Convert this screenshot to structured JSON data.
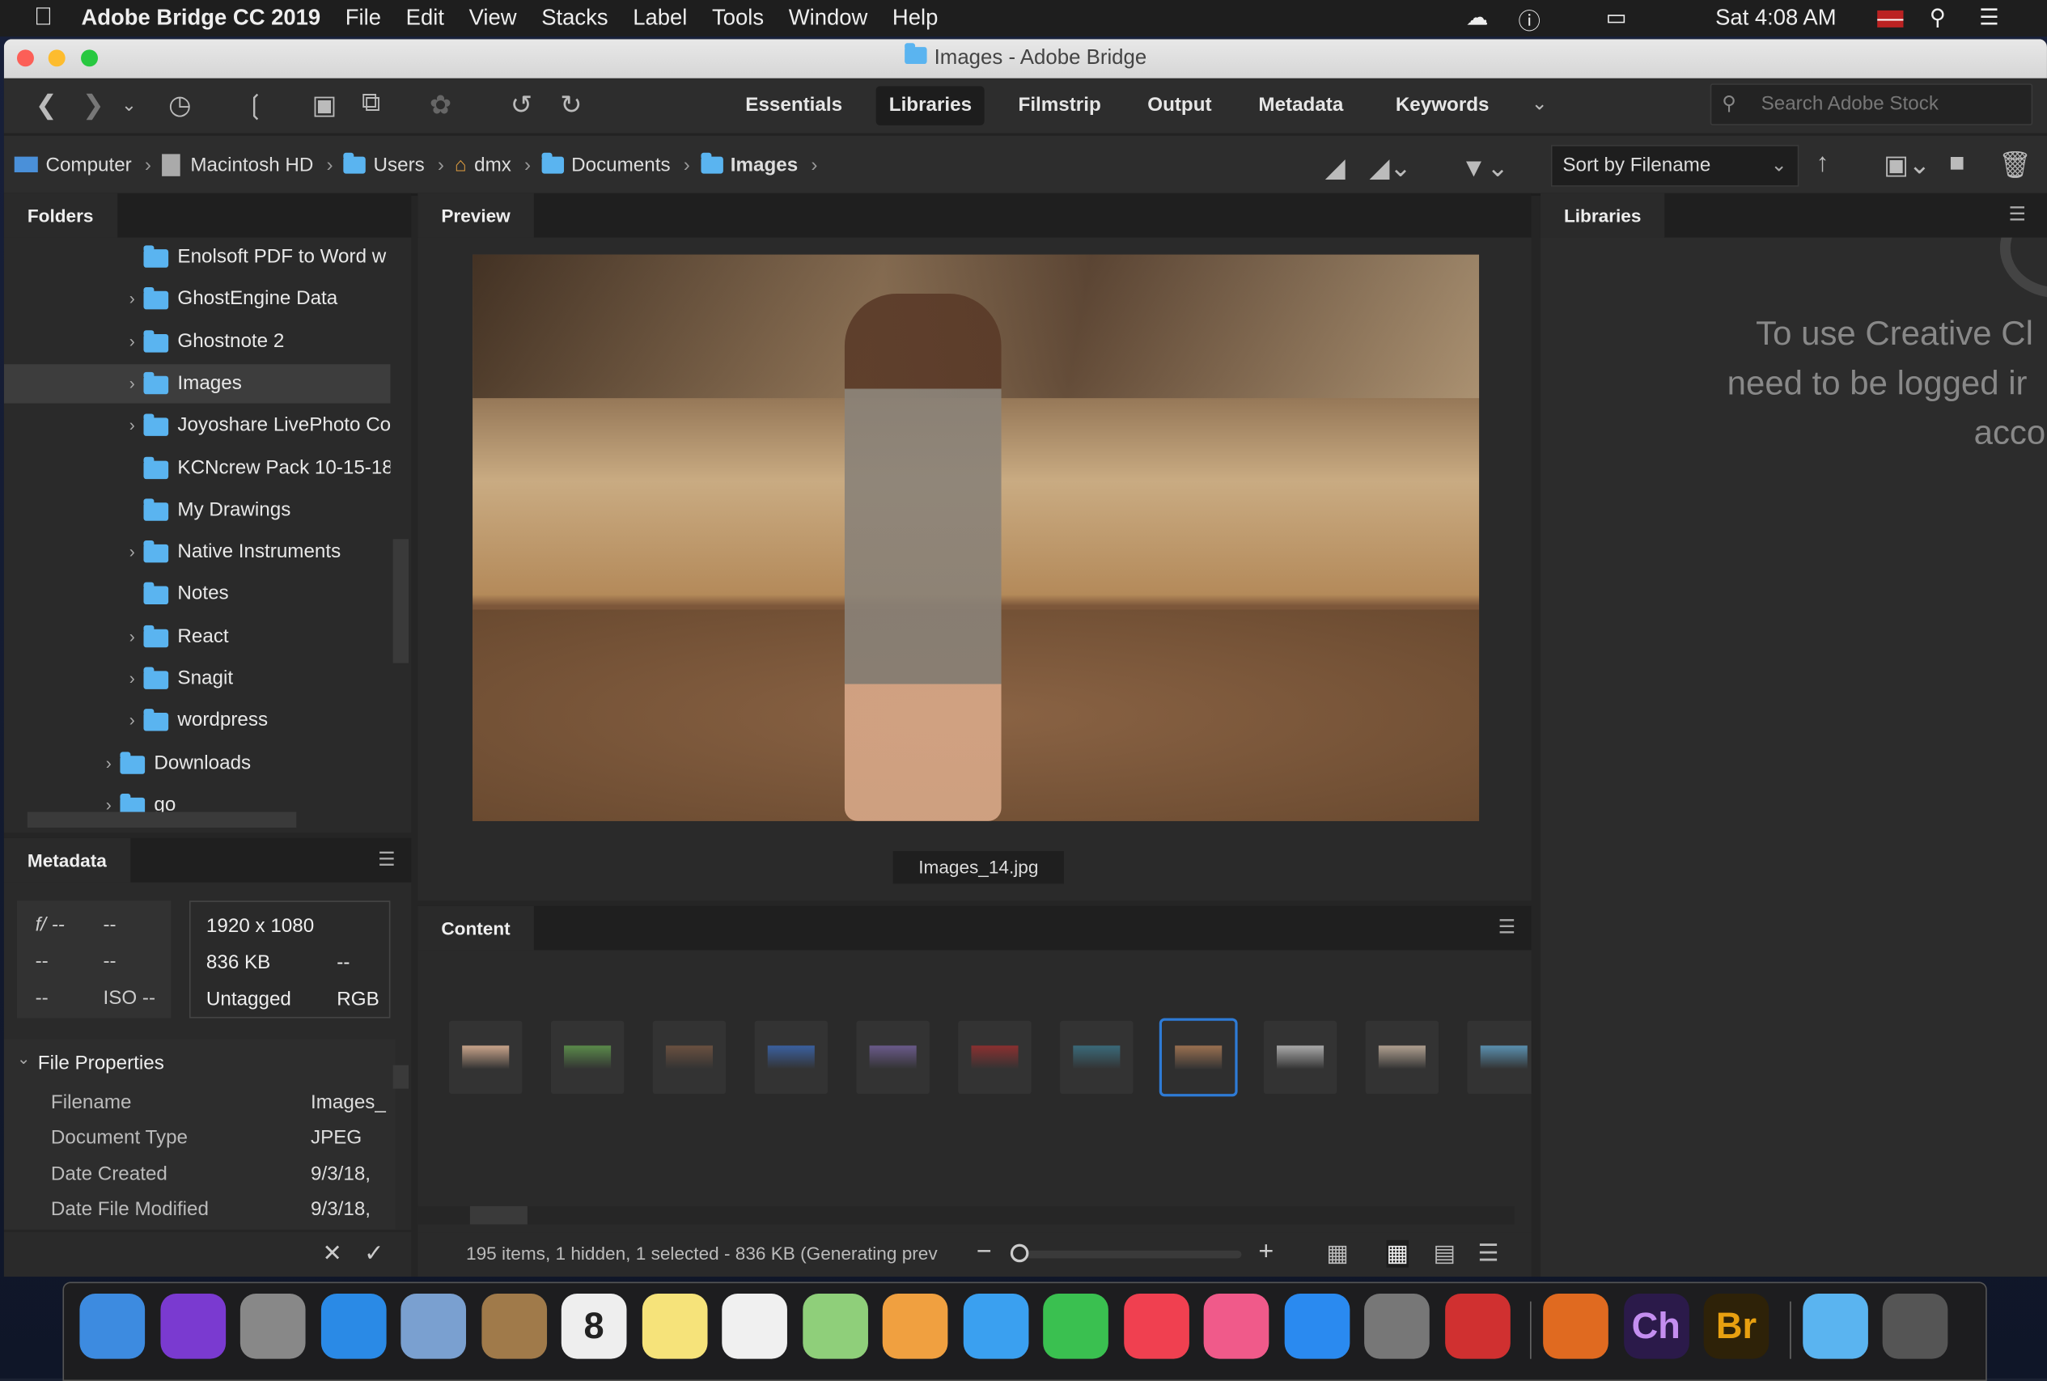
{
  "menubar": {
    "app": "Adobe Bridge CC 2019",
    "items": [
      "File",
      "Edit",
      "View",
      "Stacks",
      "Label",
      "Tools",
      "Window",
      "Help"
    ],
    "clock": "Sat 4:08 AM"
  },
  "window": {
    "title": "Images - Adobe Bridge"
  },
  "toolbar": {
    "workspaces": [
      "Essentials",
      "Libraries",
      "Filmstrip",
      "Output",
      "Metadata",
      "Keywords"
    ],
    "active_workspace": "Libraries",
    "search_placeholder": "Search Adobe Stock"
  },
  "path": {
    "crumbs": [
      "Computer",
      "Macintosh HD",
      "Users",
      "dmx",
      "Documents",
      "Images"
    ],
    "sort": "Sort by Filename"
  },
  "folders": {
    "tab": "Folders",
    "items": [
      {
        "label": "Enolsoft PDF to Word w",
        "expandable": false
      },
      {
        "label": "GhostEngine Data",
        "expandable": true
      },
      {
        "label": "Ghostnote 2",
        "expandable": true
      },
      {
        "label": "Images",
        "expandable": true,
        "selected": true
      },
      {
        "label": "Joyoshare LivePhoto Co",
        "expandable": true
      },
      {
        "label": "KCNcrew Pack 10-15-18",
        "expandable": false
      },
      {
        "label": "My Drawings",
        "expandable": false
      },
      {
        "label": "Native Instruments",
        "expandable": true
      },
      {
        "label": "Notes",
        "expandable": false
      },
      {
        "label": "React",
        "expandable": true
      },
      {
        "label": "Snagit",
        "expandable": true
      },
      {
        "label": "wordpress",
        "expandable": true
      },
      {
        "label": "Downloads",
        "expandable": true,
        "level": 0
      },
      {
        "label": "go",
        "expandable": true,
        "level": 0
      }
    ]
  },
  "metadata": {
    "tab": "Metadata",
    "camera": [
      "f/ --",
      "--",
      "--",
      "--",
      "--",
      "ISO --"
    ],
    "dimensions": "1920 x 1080",
    "size": "836 KB",
    "size_extra": "--",
    "color_profile": "Untagged",
    "color_mode": "RGB",
    "section": "File Properties",
    "props": [
      {
        "k": "Filename",
        "v": "Images_"
      },
      {
        "k": "Document Type",
        "v": "JPEG"
      },
      {
        "k": "Date Created",
        "v": "9/3/18,"
      },
      {
        "k": "Date File Modified",
        "v": "9/3/18,"
      }
    ]
  },
  "preview": {
    "tab": "Preview",
    "filename": "Images_14.jpg"
  },
  "content": {
    "tab": "Content",
    "thumb_count": 11,
    "selected_index": 7,
    "status": "195 items, 1 hidden, 1 selected - 836 KB (Generating prev"
  },
  "libraries": {
    "tab": "Libraries",
    "message": [
      "To use Creative Cl",
      "need to be logged ir",
      "acco"
    ]
  },
  "colors": {
    "accent": "#2e7bd6",
    "folder": "#5ab4f0"
  }
}
